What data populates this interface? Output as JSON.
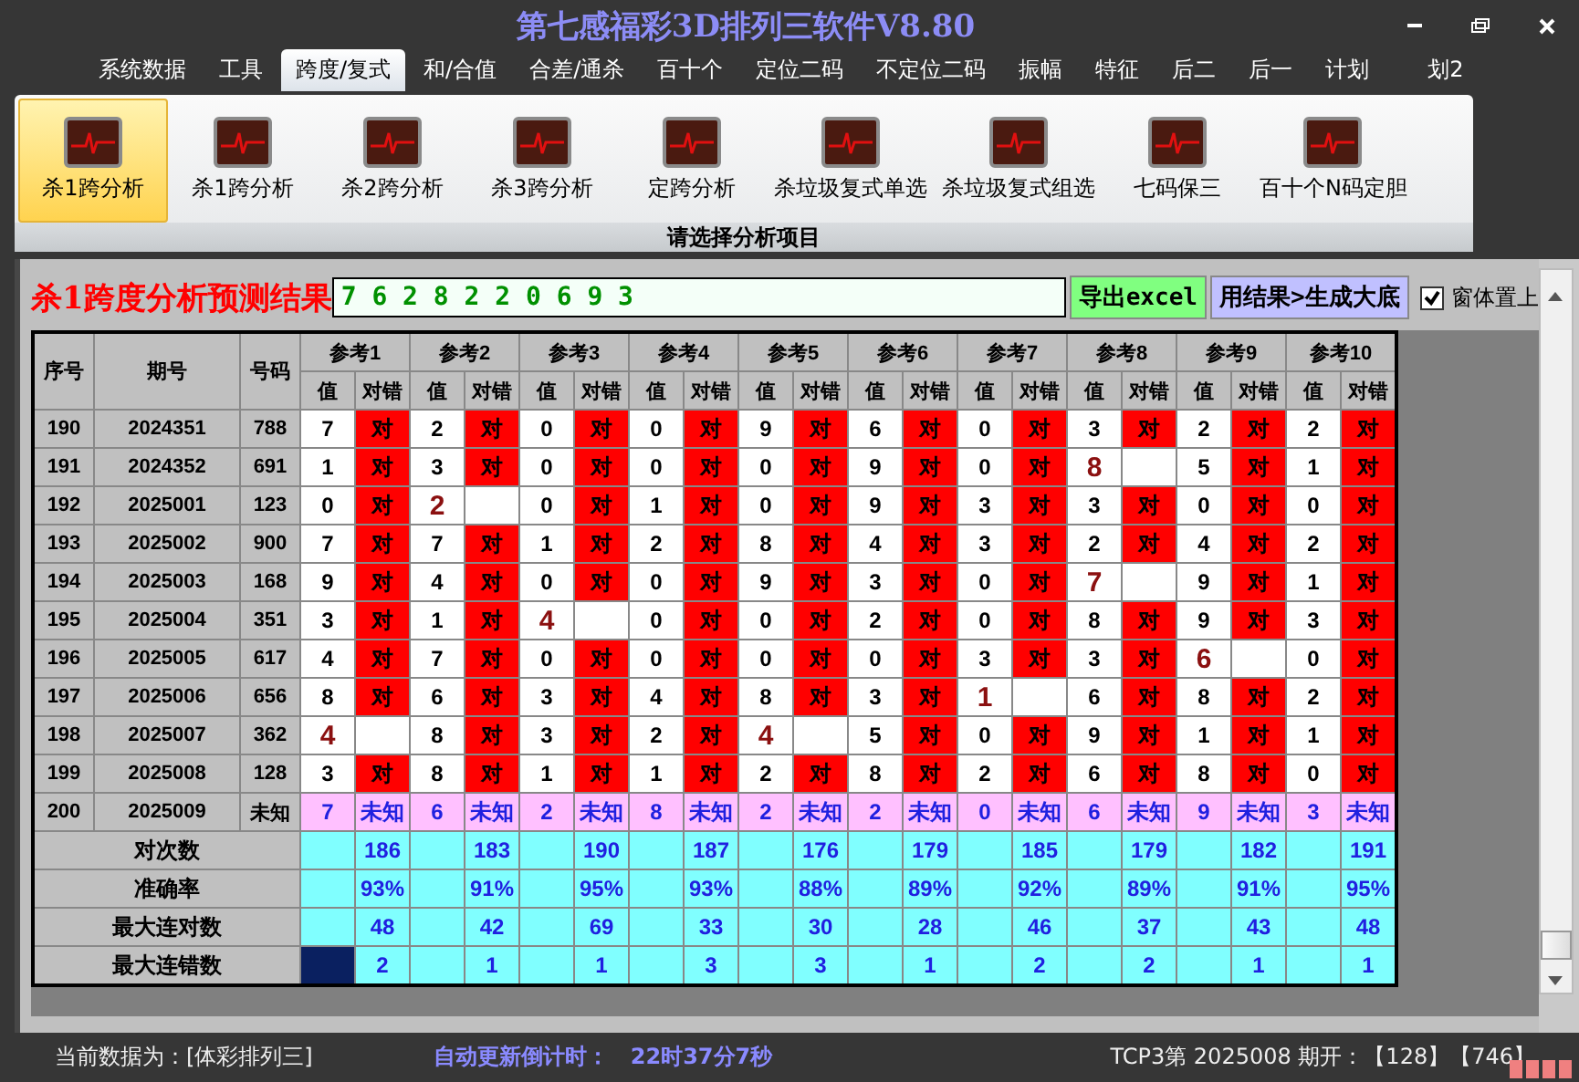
{
  "window": {
    "title": "第七感福彩3D排列三软件V8.80"
  },
  "menu_tabs": [
    {
      "label": "系统数据",
      "selected": false
    },
    {
      "label": "工具",
      "selected": false
    },
    {
      "label": "跨度/复式",
      "selected": true
    },
    {
      "label": "和/合值",
      "selected": false
    },
    {
      "label": "合差/通杀",
      "selected": false
    },
    {
      "label": "百十个",
      "selected": false
    },
    {
      "label": "定位二码",
      "selected": false
    },
    {
      "label": "不定位二码",
      "selected": false
    },
    {
      "label": "振幅",
      "selected": false
    },
    {
      "label": "特征",
      "selected": false
    },
    {
      "label": "后二",
      "selected": false
    },
    {
      "label": "后一",
      "selected": false
    },
    {
      "label": "计划",
      "selected": false
    },
    {
      "label": "划2",
      "selected": false
    }
  ],
  "ribbon": {
    "items": [
      {
        "label": "杀1跨分析",
        "selected": true
      },
      {
        "label": "杀1跨分析",
        "selected": false
      },
      {
        "label": "杀2跨分析",
        "selected": false
      },
      {
        "label": "杀3跨分析",
        "selected": false
      },
      {
        "label": "定跨分析",
        "selected": false
      },
      {
        "label": "杀垃圾复式单选",
        "selected": false
      },
      {
        "label": "杀垃圾复式组选",
        "selected": false
      },
      {
        "label": "七码保三",
        "selected": false
      },
      {
        "label": "百十个N码定胆",
        "selected": false
      }
    ],
    "group_label": "请选择分析项目"
  },
  "result": {
    "title": "杀1跨度分析预测结果",
    "value": "7 6 2 8 2 2 0 6 9 3",
    "export_button": "导出excel",
    "generate_button": "用结果>生成大底",
    "stay_on_top": {
      "label": "窗体置上",
      "checked": true
    }
  },
  "table": {
    "columns": [
      "序号",
      "期号",
      "号码"
    ],
    "groups": [
      {
        "label": "参考1",
        "value_header": "值",
        "result_header": "对错"
      },
      {
        "label": "参考2",
        "value_header": "值",
        "result_header": "对错"
      },
      {
        "label": "参考3",
        "value_header": "值",
        "result_header": "对错"
      },
      {
        "label": "参考4",
        "value_header": "值",
        "result_header": "对错"
      },
      {
        "label": "参考5",
        "value_header": "值",
        "result_header": "对错"
      },
      {
        "label": "参考6",
        "value_header": "值",
        "result_header": "对错"
      },
      {
        "label": "参考7",
        "value_header": "值",
        "result_header": "对错"
      },
      {
        "label": "参考8",
        "value_header": "值",
        "result_header": "对错"
      },
      {
        "label": "参考9",
        "value_header": "值",
        "result_header": "对错"
      },
      {
        "label": "参考10",
        "value_header": "值",
        "result_header": "对错"
      }
    ],
    "rows": [
      {
        "kind": "history",
        "seq": "190",
        "period": "2024351",
        "number": "788",
        "refs": [
          {
            "v": "7",
            "ok": true,
            "result": "对"
          },
          {
            "v": "2",
            "ok": true,
            "result": "对"
          },
          {
            "v": "0",
            "ok": true,
            "result": "对"
          },
          {
            "v": "0",
            "ok": true,
            "result": "对"
          },
          {
            "v": "9",
            "ok": true,
            "result": "对"
          },
          {
            "v": "6",
            "ok": true,
            "result": "对"
          },
          {
            "v": "0",
            "ok": true,
            "result": "对"
          },
          {
            "v": "3",
            "ok": true,
            "result": "对"
          },
          {
            "v": "2",
            "ok": true,
            "result": "对"
          },
          {
            "v": "2",
            "ok": true,
            "result": "对"
          }
        ]
      },
      {
        "kind": "history",
        "seq": "191",
        "period": "2024352",
        "number": "691",
        "refs": [
          {
            "v": "1",
            "ok": true,
            "result": "对"
          },
          {
            "v": "3",
            "ok": true,
            "result": "对"
          },
          {
            "v": "0",
            "ok": true,
            "result": "对"
          },
          {
            "v": "0",
            "ok": true,
            "result": "对"
          },
          {
            "v": "0",
            "ok": true,
            "result": "对"
          },
          {
            "v": "9",
            "ok": true,
            "result": "对"
          },
          {
            "v": "0",
            "ok": true,
            "result": "对"
          },
          {
            "v": "8",
            "ok": false
          },
          {
            "v": "5",
            "ok": true,
            "result": "对"
          },
          {
            "v": "1",
            "ok": true,
            "result": "对"
          }
        ]
      },
      {
        "kind": "history",
        "seq": "192",
        "period": "2025001",
        "number": "123",
        "refs": [
          {
            "v": "0",
            "ok": true,
            "result": "对"
          },
          {
            "v": "2",
            "ok": false
          },
          {
            "v": "0",
            "ok": true,
            "result": "对"
          },
          {
            "v": "1",
            "ok": true,
            "result": "对"
          },
          {
            "v": "0",
            "ok": true,
            "result": "对"
          },
          {
            "v": "9",
            "ok": true,
            "result": "对"
          },
          {
            "v": "3",
            "ok": true,
            "result": "对"
          },
          {
            "v": "3",
            "ok": true,
            "result": "对"
          },
          {
            "v": "0",
            "ok": true,
            "result": "对"
          },
          {
            "v": "0",
            "ok": true,
            "result": "对"
          }
        ]
      },
      {
        "kind": "history",
        "seq": "193",
        "period": "2025002",
        "number": "900",
        "refs": [
          {
            "v": "7",
            "ok": true,
            "result": "对"
          },
          {
            "v": "7",
            "ok": true,
            "result": "对"
          },
          {
            "v": "1",
            "ok": true,
            "result": "对"
          },
          {
            "v": "2",
            "ok": true,
            "result": "对"
          },
          {
            "v": "8",
            "ok": true,
            "result": "对"
          },
          {
            "v": "4",
            "ok": true,
            "result": "对"
          },
          {
            "v": "3",
            "ok": true,
            "result": "对"
          },
          {
            "v": "2",
            "ok": true,
            "result": "对"
          },
          {
            "v": "4",
            "ok": true,
            "result": "对"
          },
          {
            "v": "2",
            "ok": true,
            "result": "对"
          }
        ]
      },
      {
        "kind": "history",
        "seq": "194",
        "period": "2025003",
        "number": "168",
        "refs": [
          {
            "v": "9",
            "ok": true,
            "result": "对"
          },
          {
            "v": "4",
            "ok": true,
            "result": "对"
          },
          {
            "v": "0",
            "ok": true,
            "result": "对"
          },
          {
            "v": "0",
            "ok": true,
            "result": "对"
          },
          {
            "v": "9",
            "ok": true,
            "result": "对"
          },
          {
            "v": "3",
            "ok": true,
            "result": "对"
          },
          {
            "v": "0",
            "ok": true,
            "result": "对"
          },
          {
            "v": "7",
            "ok": false
          },
          {
            "v": "9",
            "ok": true,
            "result": "对"
          },
          {
            "v": "1",
            "ok": true,
            "result": "对"
          }
        ]
      },
      {
        "kind": "history",
        "seq": "195",
        "period": "2025004",
        "number": "351",
        "refs": [
          {
            "v": "3",
            "ok": true,
            "result": "对"
          },
          {
            "v": "1",
            "ok": true,
            "result": "对"
          },
          {
            "v": "4",
            "ok": false
          },
          {
            "v": "0",
            "ok": true,
            "result": "对"
          },
          {
            "v": "0",
            "ok": true,
            "result": "对"
          },
          {
            "v": "2",
            "ok": true,
            "result": "对"
          },
          {
            "v": "0",
            "ok": true,
            "result": "对"
          },
          {
            "v": "8",
            "ok": true,
            "result": "对"
          },
          {
            "v": "9",
            "ok": true,
            "result": "对"
          },
          {
            "v": "3",
            "ok": true,
            "result": "对"
          }
        ]
      },
      {
        "kind": "history",
        "seq": "196",
        "period": "2025005",
        "number": "617",
        "refs": [
          {
            "v": "4",
            "ok": true,
            "result": "对"
          },
          {
            "v": "7",
            "ok": true,
            "result": "对"
          },
          {
            "v": "0",
            "ok": true,
            "result": "对"
          },
          {
            "v": "0",
            "ok": true,
            "result": "对"
          },
          {
            "v": "0",
            "ok": true,
            "result": "对"
          },
          {
            "v": "0",
            "ok": true,
            "result": "对"
          },
          {
            "v": "3",
            "ok": true,
            "result": "对"
          },
          {
            "v": "3",
            "ok": true,
            "result": "对"
          },
          {
            "v": "6",
            "ok": false
          },
          {
            "v": "0",
            "ok": true,
            "result": "对"
          }
        ]
      },
      {
        "kind": "history",
        "seq": "197",
        "period": "2025006",
        "number": "656",
        "refs": [
          {
            "v": "8",
            "ok": true,
            "result": "对"
          },
          {
            "v": "6",
            "ok": true,
            "result": "对"
          },
          {
            "v": "3",
            "ok": true,
            "result": "对"
          },
          {
            "v": "4",
            "ok": true,
            "result": "对"
          },
          {
            "v": "8",
            "ok": true,
            "result": "对"
          },
          {
            "v": "3",
            "ok": true,
            "result": "对"
          },
          {
            "v": "1",
            "ok": false
          },
          {
            "v": "6",
            "ok": true,
            "result": "对"
          },
          {
            "v": "8",
            "ok": true,
            "result": "对"
          },
          {
            "v": "2",
            "ok": true,
            "result": "对"
          }
        ]
      },
      {
        "kind": "history",
        "seq": "198",
        "period": "2025007",
        "number": "362",
        "refs": [
          {
            "v": "4",
            "ok": false
          },
          {
            "v": "8",
            "ok": true,
            "result": "对"
          },
          {
            "v": "3",
            "ok": true,
            "result": "对"
          },
          {
            "v": "2",
            "ok": true,
            "result": "对"
          },
          {
            "v": "4",
            "ok": false
          },
          {
            "v": "5",
            "ok": true,
            "result": "对"
          },
          {
            "v": "0",
            "ok": true,
            "result": "对"
          },
          {
            "v": "9",
            "ok": true,
            "result": "对"
          },
          {
            "v": "1",
            "ok": true,
            "result": "对"
          },
          {
            "v": "1",
            "ok": true,
            "result": "对"
          }
        ]
      },
      {
        "kind": "history",
        "seq": "199",
        "period": "2025008",
        "number": "128",
        "refs": [
          {
            "v": "3",
            "ok": true,
            "result": "对"
          },
          {
            "v": "8",
            "ok": true,
            "result": "对"
          },
          {
            "v": "1",
            "ok": true,
            "result": "对"
          },
          {
            "v": "1",
            "ok": true,
            "result": "对"
          },
          {
            "v": "2",
            "ok": true,
            "result": "对"
          },
          {
            "v": "8",
            "ok": true,
            "result": "对"
          },
          {
            "v": "2",
            "ok": true,
            "result": "对"
          },
          {
            "v": "6",
            "ok": true,
            "result": "对"
          },
          {
            "v": "8",
            "ok": true,
            "result": "对"
          },
          {
            "v": "0",
            "ok": true,
            "result": "对"
          }
        ]
      },
      {
        "kind": "pending",
        "seq": "200",
        "period": "2025009",
        "number": "未知",
        "refs": [
          {
            "v": "7",
            "result": "未知"
          },
          {
            "v": "6",
            "result": "未知"
          },
          {
            "v": "2",
            "result": "未知"
          },
          {
            "v": "8",
            "result": "未知"
          },
          {
            "v": "2",
            "result": "未知"
          },
          {
            "v": "2",
            "result": "未知"
          },
          {
            "v": "0",
            "result": "未知"
          },
          {
            "v": "6",
            "result": "未知"
          },
          {
            "v": "9",
            "result": "未知"
          },
          {
            "v": "3",
            "result": "未知"
          }
        ]
      }
    ],
    "stats": [
      {
        "label": "对次数",
        "values": [
          "186",
          "183",
          "190",
          "187",
          "176",
          "179",
          "185",
          "179",
          "182",
          "191"
        ]
      },
      {
        "label": "准确率",
        "values": [
          "93%",
          "91%",
          "95%",
          "93%",
          "88%",
          "89%",
          "92%",
          "89%",
          "91%",
          "95%"
        ]
      },
      {
        "label": "最大连对数",
        "values": [
          "48",
          "42",
          "69",
          "33",
          "30",
          "28",
          "46",
          "37",
          "43",
          "48"
        ]
      },
      {
        "label": "最大连错数",
        "values": [
          "2",
          "1",
          "1",
          "3",
          "3",
          "1",
          "2",
          "2",
          "1",
          "1"
        ]
      }
    ]
  },
  "status_bar": {
    "current_data": "当前数据为：[体彩排列三]",
    "countdown_label": "自动更新倒计时：",
    "countdown": "22时37分7秒",
    "draw_info": "TCP3第 2025008 期开：【128】【746】"
  }
}
